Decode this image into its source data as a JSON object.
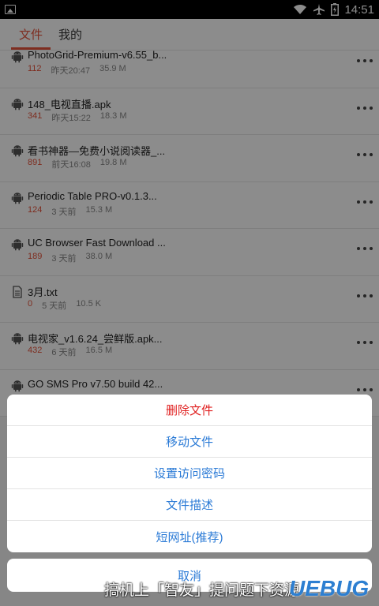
{
  "status": {
    "time": "14:51",
    "icons": [
      "image-icon",
      "wifi-icon",
      "airplane-icon",
      "battery-icon"
    ]
  },
  "tabs": [
    {
      "label": "文件"
    },
    {
      "label": "我的"
    }
  ],
  "files": [
    {
      "name": "PhotoGrid-Premium-v6.55_b...",
      "count": "112",
      "time": "昨天20:47",
      "size": "35.9 M",
      "icon": "android-icon"
    },
    {
      "name": "148_电视直播.apk",
      "count": "341",
      "time": "昨天15:22",
      "size": "18.3 M",
      "icon": "android-icon"
    },
    {
      "name": "看书神器—免费小说阅读器_...",
      "count": "891",
      "time": "前天16:08",
      "size": "19.8 M",
      "icon": "android-icon"
    },
    {
      "name": "Periodic Table PRO-v0.1.3...",
      "count": "124",
      "time": "3 天前",
      "size": "15.3 M",
      "icon": "android-icon"
    },
    {
      "name": "UC Browser Fast Download ...",
      "count": "189",
      "time": "3 天前",
      "size": "38.0 M",
      "icon": "android-icon"
    },
    {
      "name": "3月.txt",
      "count": "0",
      "time": "5 天前",
      "size": "10.5 K",
      "icon": "document-icon"
    },
    {
      "name": "电视家_v1.6.24_尝鲜版.apk...",
      "count": "432",
      "time": "6 天前",
      "size": "16.5 M",
      "icon": "android-icon"
    },
    {
      "name": "GO SMS Pro v7.50 build 42...",
      "count": "",
      "time": "",
      "size": "",
      "icon": "android-icon"
    }
  ],
  "action_sheet": {
    "items": [
      {
        "label": "删除文件",
        "danger": true
      },
      {
        "label": "移动文件"
      },
      {
        "label": "设置访问密码"
      },
      {
        "label": "文件描述"
      },
      {
        "label": "短网址(推荐)"
      }
    ],
    "cancel": "取消"
  },
  "watermark": {
    "text": "搞机上「智友」提问题下资源",
    "logo": "UEBUG"
  },
  "colors": {
    "accent": "#e5533b",
    "action_blue": "#2a7ad6",
    "danger_red": "#e02020"
  }
}
